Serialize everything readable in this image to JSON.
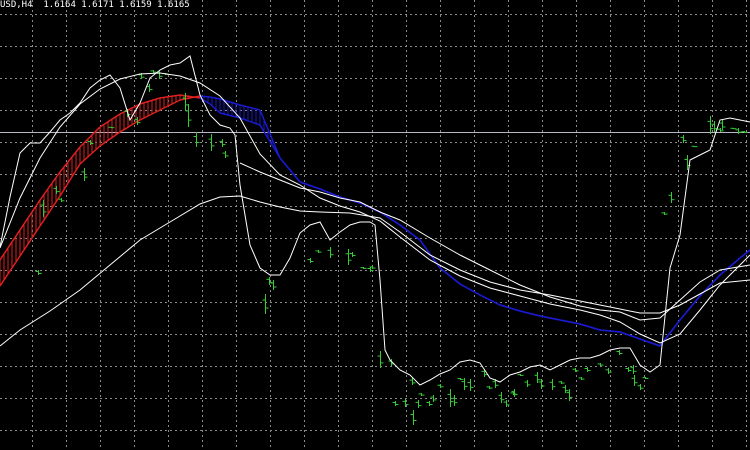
{
  "header": {
    "symbol_timeframe": "USD,H4",
    "ohlc": "1.6164 1.6171 1.6159 1.6165"
  },
  "colors": {
    "background": "#000000",
    "grid": "#8a8a8a",
    "bar": "#33cc33",
    "line": "#ffffff",
    "cloud_up": "#e02020",
    "cloud_down": "#1a1ad0",
    "level": "#b8b8c8"
  },
  "chart_data": {
    "type": "line",
    "price_bars": [
      [
        38,
        270,
        5
      ],
      [
        43,
        200,
        17
      ],
      [
        56,
        186,
        8
      ],
      [
        61,
        198,
        4
      ],
      [
        84,
        168,
        13
      ],
      [
        90,
        140,
        5
      ],
      [
        111,
        127,
        1
      ],
      [
        127,
        109,
        8
      ],
      [
        137,
        117,
        8
      ],
      [
        141,
        73,
        6
      ],
      [
        149,
        84,
        8
      ],
      [
        153,
        70,
        3
      ],
      [
        159,
        70,
        9
      ],
      [
        165,
        73,
        2
      ],
      [
        185,
        93,
        17
      ],
      [
        188,
        104,
        23
      ],
      [
        196,
        132,
        15
      ],
      [
        211,
        134,
        17
      ],
      [
        222,
        139,
        8
      ],
      [
        225,
        151,
        7
      ],
      [
        265,
        294,
        20
      ],
      [
        269,
        277,
        8
      ],
      [
        273,
        280,
        10
      ],
      [
        310,
        258,
        5
      ],
      [
        318,
        250,
        3
      ],
      [
        330,
        247,
        11
      ],
      [
        348,
        249,
        16
      ],
      [
        352,
        252,
        5
      ],
      [
        363,
        267,
        2
      ],
      [
        370,
        267,
        5
      ],
      [
        372,
        266,
        3
      ],
      [
        380,
        351,
        17
      ],
      [
        391,
        359,
        7
      ],
      [
        395,
        401,
        5
      ],
      [
        405,
        399,
        8
      ],
      [
        412,
        378,
        7
      ],
      [
        413,
        410,
        15
      ],
      [
        418,
        400,
        8
      ],
      [
        421,
        393,
        3
      ],
      [
        429,
        401,
        5
      ],
      [
        433,
        395,
        7
      ],
      [
        440,
        384,
        4
      ],
      [
        450,
        389,
        18
      ],
      [
        454,
        395,
        11
      ],
      [
        460,
        378,
        2
      ],
      [
        464,
        378,
        12
      ],
      [
        470,
        379,
        12
      ],
      [
        484,
        369,
        8
      ],
      [
        489,
        386,
        3
      ],
      [
        495,
        379,
        9
      ],
      [
        501,
        392,
        11
      ],
      [
        506,
        400,
        7
      ],
      [
        513,
        392,
        3
      ],
      [
        514,
        389,
        8
      ],
      [
        520,
        374,
        2
      ],
      [
        527,
        380,
        7
      ],
      [
        537,
        372,
        11
      ],
      [
        541,
        379,
        10
      ],
      [
        552,
        379,
        11
      ],
      [
        561,
        381,
        3
      ],
      [
        565,
        385,
        8
      ],
      [
        569,
        389,
        12
      ],
      [
        575,
        368,
        4
      ],
      [
        581,
        377,
        3
      ],
      [
        587,
        367,
        5
      ],
      [
        600,
        363,
        3
      ],
      [
        608,
        368,
        6
      ],
      [
        619,
        350,
        5
      ],
      [
        628,
        367,
        5
      ],
      [
        633,
        365,
        9
      ],
      [
        634,
        375,
        11
      ],
      [
        640,
        384,
        6
      ],
      [
        645,
        377,
        2
      ],
      [
        664,
        212,
        3
      ],
      [
        671,
        192,
        11
      ],
      [
        683,
        135,
        8
      ],
      [
        687,
        155,
        15
      ],
      [
        694,
        146,
        1
      ],
      [
        710,
        116,
        18
      ],
      [
        714,
        121,
        11
      ],
      [
        720,
        128,
        4
      ],
      [
        722,
        120,
        10
      ],
      [
        733,
        128,
        1
      ],
      [
        738,
        128,
        6
      ],
      [
        744,
        131,
        2
      ]
    ],
    "levels": [
      132
    ],
    "series": [
      {
        "values": [
          [
            0,
            247
          ],
          [
            10,
            197
          ],
          [
            20,
            153
          ],
          [
            30,
            143
          ],
          [
            40,
            143
          ],
          [
            50,
            132
          ],
          [
            60,
            120
          ],
          [
            70,
            113
          ],
          [
            80,
            103
          ],
          [
            90,
            88
          ],
          [
            100,
            80
          ],
          [
            110,
            75
          ],
          [
            120,
            88
          ],
          [
            130,
            120
          ],
          [
            140,
            103
          ],
          [
            150,
            78
          ],
          [
            160,
            70
          ],
          [
            170,
            65
          ],
          [
            180,
            63
          ],
          [
            190,
            56
          ],
          [
            200,
            95
          ],
          [
            210,
            115
          ],
          [
            220,
            125
          ],
          [
            230,
            128
          ],
          [
            235,
            135
          ],
          [
            240,
            185
          ],
          [
            250,
            245
          ],
          [
            260,
            268
          ],
          [
            270,
            275
          ],
          [
            280,
            275
          ],
          [
            290,
            258
          ],
          [
            300,
            233
          ],
          [
            310,
            225
          ],
          [
            320,
            222
          ],
          [
            330,
            240
          ],
          [
            340,
            232
          ],
          [
            350,
            225
          ],
          [
            360,
            222
          ],
          [
            370,
            222
          ],
          [
            375,
            225
          ],
          [
            380,
            280
          ],
          [
            385,
            350
          ],
          [
            390,
            360
          ],
          [
            400,
            370
          ],
          [
            410,
            375
          ],
          [
            420,
            385
          ],
          [
            430,
            380
          ],
          [
            440,
            374
          ],
          [
            450,
            370
          ],
          [
            460,
            362
          ],
          [
            470,
            360
          ],
          [
            480,
            363
          ],
          [
            490,
            378
          ],
          [
            500,
            382
          ],
          [
            510,
            375
          ],
          [
            520,
            372
          ],
          [
            530,
            367
          ],
          [
            540,
            365
          ],
          [
            550,
            370
          ],
          [
            560,
            365
          ],
          [
            570,
            360
          ],
          [
            580,
            358
          ],
          [
            590,
            358
          ],
          [
            600,
            355
          ],
          [
            610,
            350
          ],
          [
            620,
            348
          ],
          [
            630,
            348
          ],
          [
            640,
            365
          ],
          [
            650,
            372
          ],
          [
            660,
            365
          ],
          [
            670,
            268
          ],
          [
            680,
            235
          ],
          [
            690,
            160
          ],
          [
            700,
            155
          ],
          [
            710,
            150
          ],
          [
            720,
            120
          ],
          [
            730,
            118
          ],
          [
            740,
            120
          ],
          [
            750,
            122
          ]
        ]
      },
      {
        "values": [
          [
            0,
            346
          ],
          [
            20,
            330
          ],
          [
            50,
            311
          ],
          [
            80,
            290
          ],
          [
            110,
            265
          ],
          [
            140,
            240
          ],
          [
            170,
            222
          ],
          [
            200,
            204
          ],
          [
            220,
            197
          ],
          [
            240,
            196
          ],
          [
            260,
            202
          ],
          [
            280,
            207
          ],
          [
            300,
            211
          ],
          [
            320,
            212
          ],
          [
            350,
            213
          ],
          [
            380,
            218
          ],
          [
            400,
            232
          ],
          [
            430,
            255
          ],
          [
            460,
            270
          ],
          [
            490,
            282
          ],
          [
            520,
            290
          ],
          [
            550,
            295
          ],
          [
            580,
            301
          ],
          [
            600,
            305
          ],
          [
            620,
            309
          ],
          [
            640,
            313
          ],
          [
            660,
            313
          ],
          [
            680,
            305
          ],
          [
            700,
            294
          ],
          [
            720,
            283
          ],
          [
            750,
            280
          ]
        ]
      },
      {
        "values": [
          [
            0,
            248
          ],
          [
            20,
            198
          ],
          [
            40,
            158
          ],
          [
            60,
            127
          ],
          [
            80,
            104
          ],
          [
            100,
            89
          ],
          [
            120,
            79
          ],
          [
            140,
            74
          ],
          [
            160,
            73
          ],
          [
            180,
            76
          ],
          [
            200,
            83
          ],
          [
            220,
            96
          ],
          [
            240,
            118
          ],
          [
            260,
            154
          ],
          [
            280,
            175
          ],
          [
            300,
            185
          ],
          [
            320,
            198
          ],
          [
            340,
            206
          ],
          [
            360,
            212
          ],
          [
            380,
            221
          ],
          [
            400,
            237
          ],
          [
            430,
            260
          ],
          [
            460,
            276
          ],
          [
            490,
            288
          ],
          [
            520,
            296
          ],
          [
            550,
            304
          ],
          [
            580,
            310
          ],
          [
            600,
            315
          ],
          [
            620,
            322
          ],
          [
            640,
            334
          ],
          [
            660,
            343
          ],
          [
            680,
            334
          ],
          [
            700,
            310
          ],
          [
            720,
            285
          ],
          [
            750,
            255
          ]
        ]
      },
      {
        "values": [
          [
            240,
            163
          ],
          [
            260,
            172
          ],
          [
            280,
            180
          ],
          [
            300,
            188
          ],
          [
            320,
            192
          ],
          [
            340,
            198
          ],
          [
            360,
            202
          ],
          [
            380,
            212
          ],
          [
            400,
            220
          ],
          [
            430,
            238
          ],
          [
            460,
            255
          ],
          [
            490,
            270
          ],
          [
            520,
            285
          ],
          [
            550,
            297
          ],
          [
            580,
            306
          ],
          [
            600,
            310
          ],
          [
            620,
            312
          ],
          [
            640,
            320
          ],
          [
            660,
            318
          ],
          [
            680,
            300
          ],
          [
            700,
            282
          ],
          [
            720,
            270
          ],
          [
            750,
            265
          ]
        ]
      }
    ],
    "cloud": {
      "x": [
        0,
        20,
        40,
        60,
        80,
        100,
        120,
        140,
        160,
        180,
        200,
        210,
        220,
        240,
        260,
        280,
        300,
        320,
        340,
        360,
        380,
        400,
        420,
        440,
        460,
        480,
        500,
        520,
        540,
        560,
        580,
        600,
        620,
        640,
        660,
        680,
        700,
        720,
        740,
        750
      ],
      "line1": [
        286,
        256,
        226,
        196,
        164,
        146,
        132,
        120,
        110,
        100,
        96,
        97,
        99,
        105,
        110,
        158,
        182,
        189,
        197,
        203,
        212,
        225,
        240,
        268,
        284,
        295,
        305,
        311,
        316,
        320,
        324,
        330,
        332,
        339,
        346,
        320,
        296,
        275,
        258,
        250
      ],
      "line2": [
        260,
        230,
        200,
        172,
        147,
        127,
        114,
        104,
        98,
        95,
        98,
        104,
        113,
        118,
        125,
        158,
        182,
        189,
        197,
        203,
        212,
        225,
        240,
        268,
        284,
        295,
        305,
        311,
        316,
        320,
        324,
        330,
        332,
        339,
        346,
        320,
        296,
        275,
        258,
        250
      ]
    }
  }
}
